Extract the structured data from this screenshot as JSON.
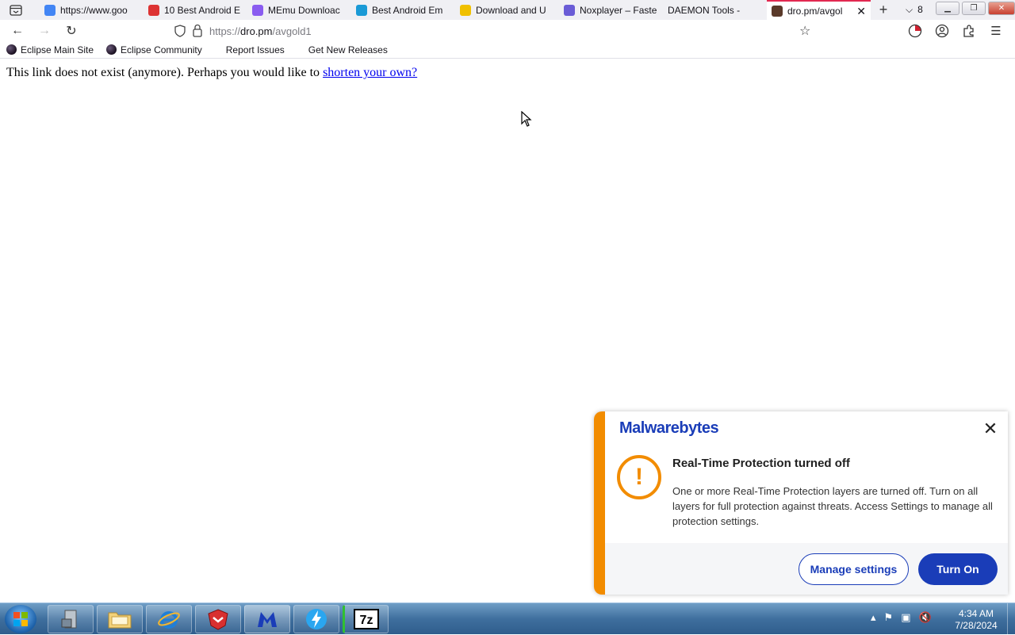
{
  "browser": {
    "tabs": [
      {
        "title": "https://www.goo",
        "icon": "google-icon",
        "color": "#4285f4"
      },
      {
        "title": "10 Best Android E",
        "icon": "site-icon",
        "color": "#d33"
      },
      {
        "title": "MEmu Downloac",
        "icon": "memu-icon",
        "color": "#8a5cf0"
      },
      {
        "title": "Best Android Em",
        "icon": "site-icon",
        "color": "#1a9ad6"
      },
      {
        "title": "Download and U",
        "icon": "site-icon",
        "color": "#f0c000"
      },
      {
        "title": "Noxplayer – Faste",
        "icon": "nox-icon",
        "color": "#6a5cd6"
      },
      {
        "title": "DAEMON Tools -",
        "icon": "",
        "color": ""
      },
      {
        "title": "dro.pm/avgol",
        "icon": "site-icon",
        "color": "#5a3a2a",
        "active": true
      }
    ],
    "tab_count": "8",
    "url_prefix": "https://",
    "url_host": "dro.pm",
    "url_path": "/avgold1",
    "bookmarks": [
      {
        "label": "Eclipse Main Site",
        "icon": "eclipse-icon"
      },
      {
        "label": "Eclipse Community",
        "icon": "eclipse-icon"
      },
      {
        "label": "Report Issues",
        "icon": ""
      },
      {
        "label": "Get New Releases",
        "icon": ""
      }
    ]
  },
  "page": {
    "message": "This link does not exist (anymore). Perhaps you would like to ",
    "link_text": "shorten your own?"
  },
  "toast": {
    "brand": "Malwarebytes",
    "heading": "Real-Time Protection turned off",
    "body": "One or more Real-Time Protection layers are turned off. Turn on all layers for full protection against threats. Access Settings to manage all protection settings.",
    "manage_label": "Manage settings",
    "turn_on_label": "Turn On",
    "accent": "#f28c00",
    "brand_color": "#1a3db8"
  },
  "taskbar": {
    "time": "4:34 AM",
    "date": "7/28/2024"
  }
}
